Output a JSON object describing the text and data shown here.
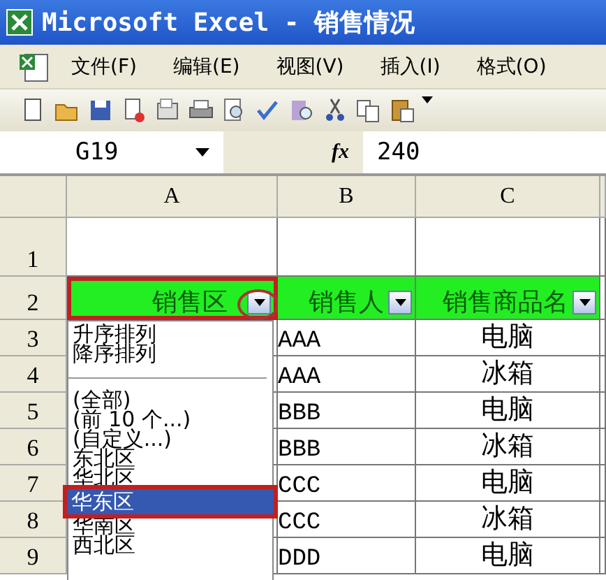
{
  "window": {
    "title": "Microsoft Excel - 销售情况"
  },
  "menu": [
    {
      "label": "文件(F)"
    },
    {
      "label": "编辑(E)"
    },
    {
      "label": "视图(V)"
    },
    {
      "label": "插入(I)"
    },
    {
      "label": "格式(O)"
    }
  ],
  "formula_bar": {
    "name_box": "G19",
    "function_label": "fx",
    "formula": "240"
  },
  "columns": [
    "A",
    "B",
    "C"
  ],
  "rows": [
    {
      "number": "1",
      "cells": []
    },
    {
      "number": "2",
      "kind": "header",
      "cells": [
        {
          "text": "销售区",
          "annotated": true
        },
        {
          "text": "销售人",
          "annotated": false
        },
        {
          "text": "销售商品名",
          "annotated": false
        }
      ]
    },
    {
      "number": "3",
      "cells": [
        "AAA",
        "电脑"
      ]
    },
    {
      "number": "4",
      "cells": [
        "AAA",
        "冰箱"
      ]
    },
    {
      "number": "5",
      "cells": [
        "BBB",
        "电脑"
      ]
    },
    {
      "number": "6",
      "cells": [
        "BBB",
        "冰箱"
      ]
    },
    {
      "number": "7",
      "cells": [
        "CCC",
        "电脑"
      ]
    },
    {
      "number": "8",
      "cells": [
        "CCC",
        "冰箱"
      ]
    },
    {
      "number": "9",
      "cells": [
        "DDD",
        "电脑"
      ]
    }
  ],
  "filter_dropdown": {
    "sort_items": [
      "升序排列",
      "降序排列"
    ],
    "items": [
      {
        "label": "(全部)",
        "selected": false
      },
      {
        "label": "(前 10 个...)",
        "selected": false
      },
      {
        "label": "(自定义...)",
        "selected": false
      },
      {
        "label": "东北区",
        "selected": false
      },
      {
        "label": "华北区",
        "selected": false
      },
      {
        "label": "华东区",
        "selected": true
      },
      {
        "label": "华南区",
        "selected": false
      },
      {
        "label": "西北区",
        "selected": false
      }
    ]
  }
}
